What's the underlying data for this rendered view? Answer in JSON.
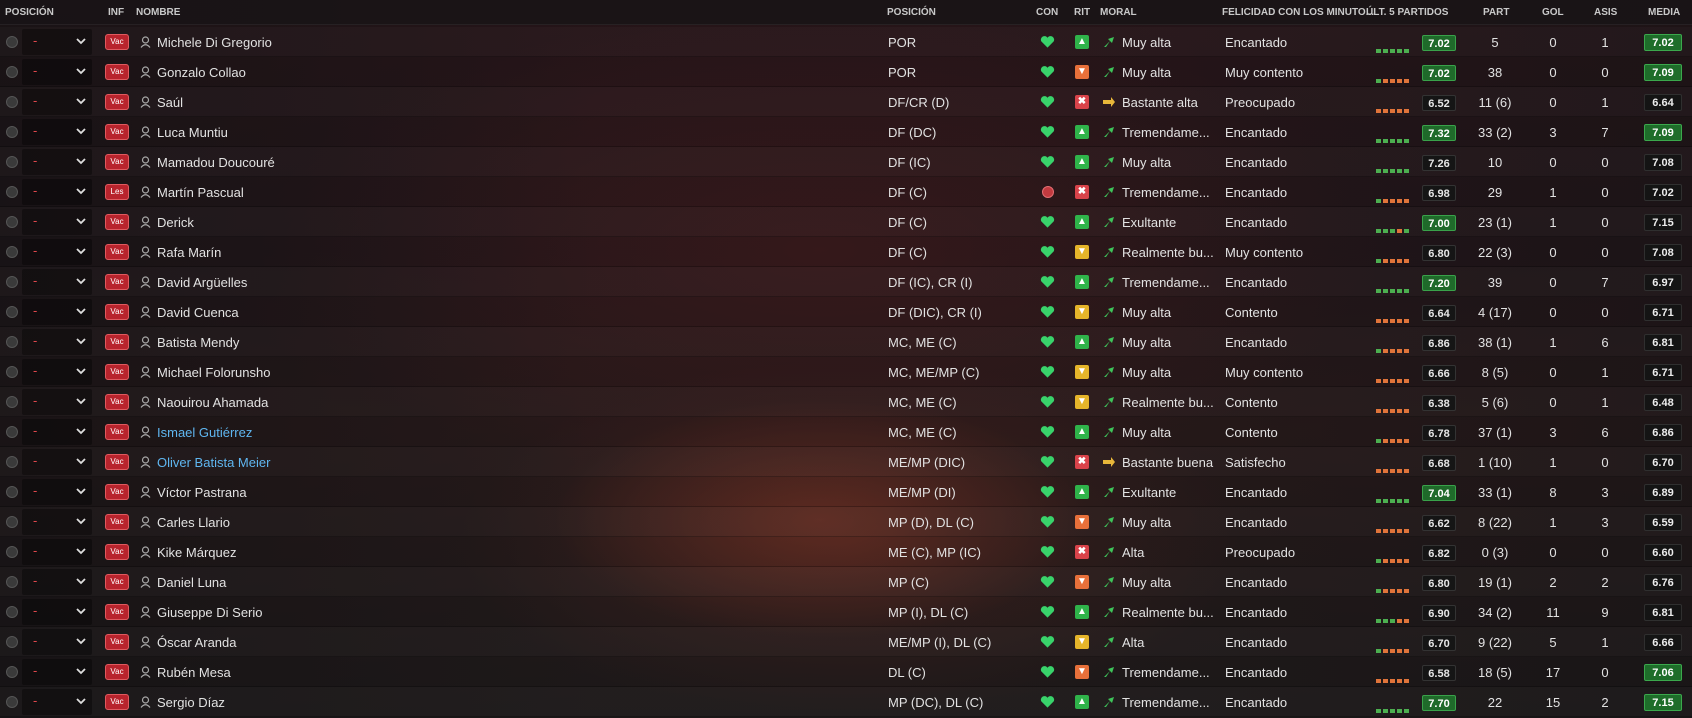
{
  "header": {
    "col_position": "POSICIÓN",
    "col_inf": "INF",
    "col_name": "NOMBRE",
    "col_positions": "POSICIÓN",
    "col_con": "CON",
    "col_rit": "RIT",
    "col_morale": "MORAL",
    "col_happiness": "FELICIDAD CON LOS MINUTO...",
    "col_last5": "ÚLT. 5 PARTIDOS",
    "col_apps": "PART",
    "col_goals": "GOL",
    "col_assists": "ASIS",
    "col_avg": "MEDIA"
  },
  "colors": {
    "form_green": "#4caf50",
    "form_orange": "#e0743a",
    "rit_green": "#2fb34a",
    "rit_orange": "#e8703a",
    "rit_red": "#d9434a",
    "rit_yellow": "#e6b52a",
    "heart": "#39d36b"
  },
  "players": [
    {
      "pos": "-",
      "inf": "Vac",
      "name": "Michele Di Gregorio",
      "positions": "POR",
      "cond": "heart",
      "rit": "green",
      "morale": "Muy alta",
      "morale_icon": "up",
      "happiness": "Encantado",
      "form": "ggggg",
      "last5": "7.02",
      "last5_style": "green",
      "apps": "5",
      "goals": "0",
      "assists": "1",
      "avg": "7.02",
      "avg_style": "green",
      "link": false
    },
    {
      "pos": "-",
      "inf": "Vac",
      "name": "Gonzalo Collao",
      "positions": "POR",
      "cond": "heart",
      "rit": "orange",
      "morale": "Muy alta",
      "morale_icon": "up",
      "happiness": "Muy contento",
      "form": "goooo",
      "last5": "7.02",
      "last5_style": "green",
      "apps": "38",
      "goals": "0",
      "assists": "0",
      "avg": "7.09",
      "avg_style": "green",
      "link": false
    },
    {
      "pos": "-",
      "inf": "Vac",
      "name": "Saúl",
      "positions": "DF/CR (D)",
      "cond": "heart",
      "rit": "red",
      "morale": "Bastante alta",
      "morale_icon": "side",
      "happiness": "Preocupado",
      "form": "ooooo",
      "last5": "6.52",
      "last5_style": "dark",
      "apps": "11 (6)",
      "goals": "0",
      "assists": "1",
      "avg": "6.64",
      "avg_style": "dark",
      "link": false
    },
    {
      "pos": "-",
      "inf": "Vac",
      "name": "Luca Muntiu",
      "positions": "DF (DC)",
      "cond": "heart",
      "rit": "green",
      "morale": "Tremendame...",
      "morale_icon": "up",
      "happiness": "Encantado",
      "form": "ggggg",
      "last5": "7.32",
      "last5_style": "green",
      "apps": "33 (2)",
      "goals": "3",
      "assists": "7",
      "avg": "7.09",
      "avg_style": "green",
      "link": false
    },
    {
      "pos": "-",
      "inf": "Vac",
      "name": "Mamadou Doucouré",
      "positions": "DF (IC)",
      "cond": "heart",
      "rit": "green",
      "morale": "Muy alta",
      "morale_icon": "up",
      "happiness": "Encantado",
      "form": "ggggg",
      "last5": "7.26",
      "last5_style": "dark",
      "apps": "10",
      "goals": "0",
      "assists": "0",
      "avg": "7.08",
      "avg_style": "dark",
      "link": false
    },
    {
      "pos": "-",
      "inf": "Les",
      "name": "Martín Pascual",
      "positions": "DF (C)",
      "cond": "injury",
      "rit": "red",
      "morale": "Tremendame...",
      "morale_icon": "up",
      "happiness": "Encantado",
      "form": "goooo",
      "last5": "6.98",
      "last5_style": "dark",
      "apps": "29",
      "goals": "1",
      "assists": "0",
      "avg": "7.02",
      "avg_style": "dark",
      "link": false
    },
    {
      "pos": "-",
      "inf": "Vac",
      "name": "Derick",
      "positions": "DF (C)",
      "cond": "heart",
      "rit": "green",
      "morale": "Exultante",
      "morale_icon": "up",
      "happiness": "Encantado",
      "form": "gggog",
      "last5": "7.00",
      "last5_style": "green",
      "apps": "23 (1)",
      "goals": "1",
      "assists": "0",
      "avg": "7.15",
      "avg_style": "dark",
      "link": false
    },
    {
      "pos": "-",
      "inf": "Vac",
      "name": "Rafa Marín",
      "positions": "DF (C)",
      "cond": "heart",
      "rit": "yellow",
      "morale": "Realmente bu...",
      "morale_icon": "up",
      "happiness": "Muy contento",
      "form": "goooo",
      "last5": "6.80",
      "last5_style": "dark",
      "apps": "22 (3)",
      "goals": "0",
      "assists": "0",
      "avg": "7.08",
      "avg_style": "dark",
      "link": false
    },
    {
      "pos": "-",
      "inf": "Vac",
      "name": "David Argüelles",
      "positions": "DF (IC), CR (I)",
      "cond": "heart",
      "rit": "green",
      "morale": "Tremendame...",
      "morale_icon": "up",
      "happiness": "Encantado",
      "form": "ggggg",
      "last5": "7.20",
      "last5_style": "green",
      "apps": "39",
      "goals": "0",
      "assists": "7",
      "avg": "6.97",
      "avg_style": "dark",
      "link": false
    },
    {
      "pos": "-",
      "inf": "Vac",
      "name": "David Cuenca",
      "positions": "DF (DIC), CR (I)",
      "cond": "heart",
      "rit": "yellow",
      "morale": "Muy alta",
      "morale_icon": "up",
      "happiness": "Contento",
      "form": "ooooo",
      "last5": "6.64",
      "last5_style": "dark",
      "apps": "4 (17)",
      "goals": "0",
      "assists": "0",
      "avg": "6.71",
      "avg_style": "dark",
      "link": false
    },
    {
      "pos": "-",
      "inf": "Vac",
      "name": "Batista Mendy",
      "positions": "MC, ME (C)",
      "cond": "heart",
      "rit": "green",
      "morale": "Muy alta",
      "morale_icon": "up",
      "happiness": "Encantado",
      "form": "goooo",
      "last5": "6.86",
      "last5_style": "dark",
      "apps": "38 (1)",
      "goals": "1",
      "assists": "6",
      "avg": "6.81",
      "avg_style": "dark",
      "link": false
    },
    {
      "pos": "-",
      "inf": "Vac",
      "name": "Michael Folorunsho",
      "positions": "MC, ME/MP (C)",
      "cond": "heart",
      "rit": "yellow",
      "morale": "Muy alta",
      "morale_icon": "up",
      "happiness": "Muy contento",
      "form": "ooooo",
      "last5": "6.66",
      "last5_style": "dark",
      "apps": "8 (5)",
      "goals": "0",
      "assists": "1",
      "avg": "6.71",
      "avg_style": "dark",
      "link": false
    },
    {
      "pos": "-",
      "inf": "Vac",
      "name": "Naouirou Ahamada",
      "positions": "MC, ME (C)",
      "cond": "heart",
      "rit": "yellow",
      "morale": "Realmente bu...",
      "morale_icon": "up",
      "happiness": "Contento",
      "form": "ooooo",
      "last5": "6.38",
      "last5_style": "dark",
      "apps": "5 (6)",
      "goals": "0",
      "assists": "1",
      "avg": "6.48",
      "avg_style": "dark",
      "link": false
    },
    {
      "pos": "-",
      "inf": "Vac",
      "name": "Ismael Gutiérrez",
      "positions": "MC, ME (C)",
      "cond": "heart",
      "rit": "green",
      "morale": "Muy alta",
      "morale_icon": "up",
      "happiness": "Contento",
      "form": "goooo",
      "last5": "6.78",
      "last5_style": "dark",
      "apps": "37 (1)",
      "goals": "3",
      "assists": "6",
      "avg": "6.86",
      "avg_style": "dark",
      "link": true
    },
    {
      "pos": "-",
      "inf": "Vac",
      "name": "Oliver Batista Meier",
      "positions": "ME/MP (DIC)",
      "cond": "heart",
      "rit": "red",
      "morale": "Bastante buena",
      "morale_icon": "side",
      "happiness": "Satisfecho",
      "form": "ooooo",
      "last5": "6.68",
      "last5_style": "dark",
      "apps": "1 (10)",
      "goals": "1",
      "assists": "0",
      "avg": "6.70",
      "avg_style": "dark",
      "link": true
    },
    {
      "pos": "-",
      "inf": "Vac",
      "name": "Víctor Pastrana",
      "positions": "ME/MP (DI)",
      "cond": "heart",
      "rit": "green",
      "morale": "Exultante",
      "morale_icon": "up",
      "happiness": "Encantado",
      "form": "ggggg",
      "last5": "7.04",
      "last5_style": "green",
      "apps": "33 (1)",
      "goals": "8",
      "assists": "3",
      "avg": "6.89",
      "avg_style": "dark",
      "link": false
    },
    {
      "pos": "-",
      "inf": "Vac",
      "name": "Carles Llario",
      "positions": "MP (D), DL (C)",
      "cond": "heart",
      "rit": "orange",
      "morale": "Muy alta",
      "morale_icon": "up",
      "happiness": "Encantado",
      "form": "ooooo",
      "last5": "6.62",
      "last5_style": "dark",
      "apps": "8 (22)",
      "goals": "1",
      "assists": "3",
      "avg": "6.59",
      "avg_style": "dark",
      "link": false
    },
    {
      "pos": "-",
      "inf": "Vac",
      "name": "Kike Márquez",
      "positions": "ME (C), MP (IC)",
      "cond": "heart",
      "rit": "red",
      "morale": "Alta",
      "morale_icon": "up",
      "happiness": "Preocupado",
      "form": "goooo",
      "last5": "6.82",
      "last5_style": "dark",
      "apps": "0 (3)",
      "goals": "0",
      "assists": "0",
      "avg": "6.60",
      "avg_style": "dark",
      "link": false
    },
    {
      "pos": "-",
      "inf": "Vac",
      "name": "Daniel Luna",
      "positions": "MP (C)",
      "cond": "heart",
      "rit": "orange",
      "morale": "Muy alta",
      "morale_icon": "up",
      "happiness": "Encantado",
      "form": "goooo",
      "last5": "6.80",
      "last5_style": "dark",
      "apps": "19 (1)",
      "goals": "2",
      "assists": "2",
      "avg": "6.76",
      "avg_style": "dark",
      "link": false
    },
    {
      "pos": "-",
      "inf": "Vac",
      "name": "Giuseppe Di Serio",
      "positions": "MP (I), DL (C)",
      "cond": "heart",
      "rit": "green",
      "morale": "Realmente bu...",
      "morale_icon": "up",
      "happiness": "Encantado",
      "form": "gggoo",
      "last5": "6.90",
      "last5_style": "dark",
      "apps": "34 (2)",
      "goals": "11",
      "assists": "9",
      "avg": "6.81",
      "avg_style": "dark",
      "link": false
    },
    {
      "pos": "-",
      "inf": "Vac",
      "name": "Óscar Aranda",
      "positions": "ME/MP (I), DL (C)",
      "cond": "heart",
      "rit": "yellow",
      "morale": "Alta",
      "morale_icon": "up",
      "happiness": "Encantado",
      "form": "goooo",
      "last5": "6.70",
      "last5_style": "dark",
      "apps": "9 (22)",
      "goals": "5",
      "assists": "1",
      "avg": "6.66",
      "avg_style": "dark",
      "link": false
    },
    {
      "pos": "-",
      "inf": "Vac",
      "name": "Rubén Mesa",
      "positions": "DL (C)",
      "cond": "heart",
      "rit": "orange",
      "morale": "Tremendame...",
      "morale_icon": "up",
      "happiness": "Encantado",
      "form": "ooooo",
      "last5": "6.58",
      "last5_style": "dark",
      "apps": "18 (5)",
      "goals": "17",
      "assists": "0",
      "avg": "7.06",
      "avg_style": "green",
      "link": false
    },
    {
      "pos": "-",
      "inf": "Vac",
      "name": "Sergio Díaz",
      "positions": "MP (DC), DL (C)",
      "cond": "heart",
      "rit": "green",
      "morale": "Tremendame...",
      "morale_icon": "up",
      "happiness": "Encantado",
      "form": "ggggg",
      "last5": "7.70",
      "last5_style": "green",
      "apps": "22",
      "goals": "15",
      "assists": "2",
      "avg": "7.15",
      "avg_style": "green",
      "link": false
    }
  ]
}
